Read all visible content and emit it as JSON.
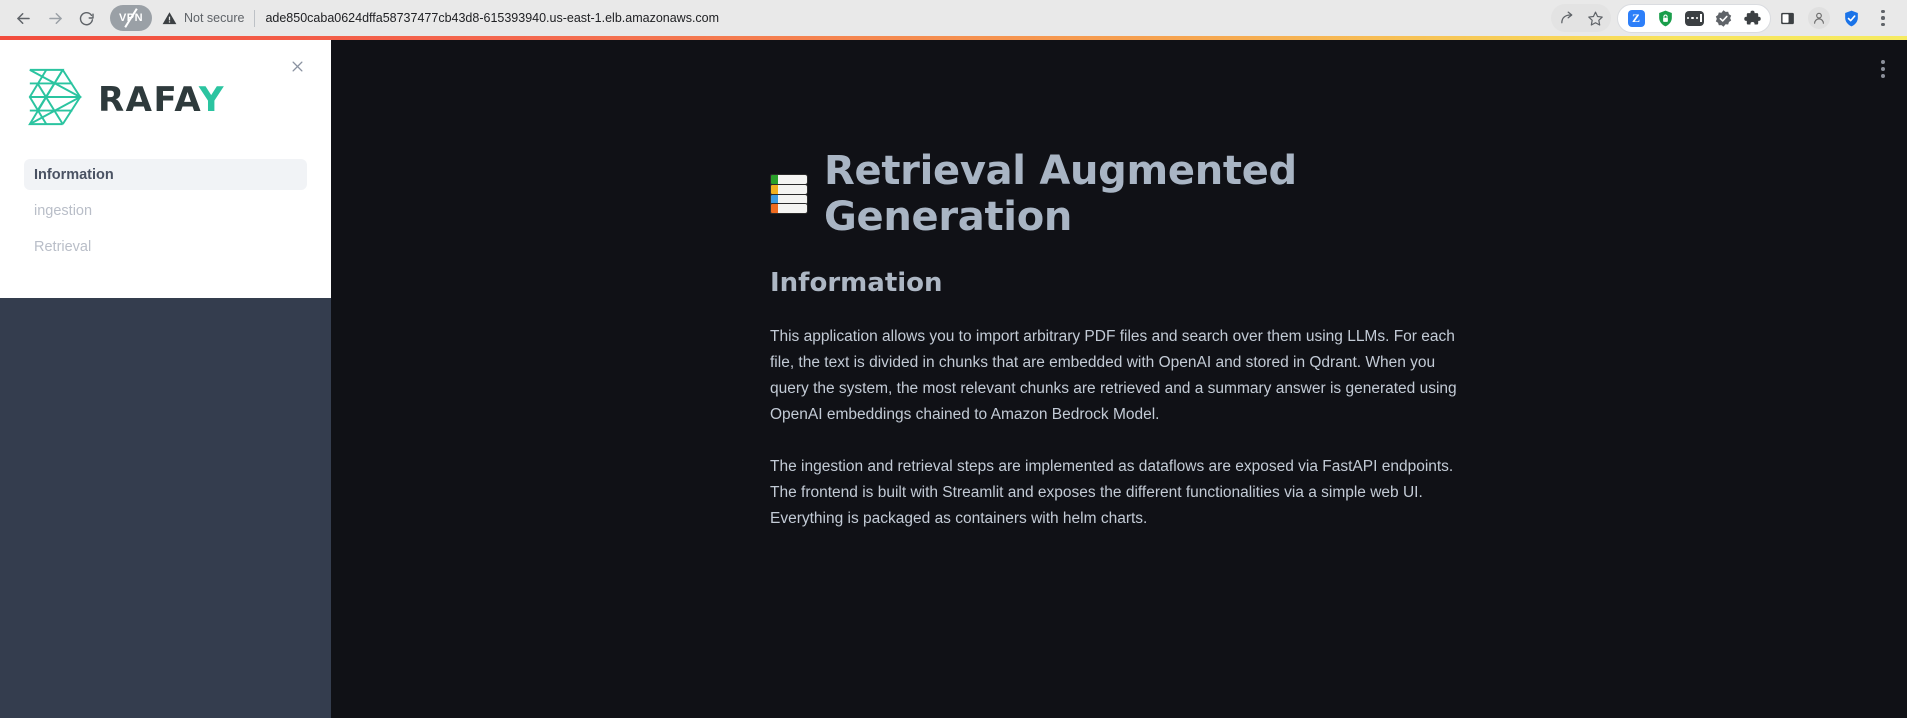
{
  "browser": {
    "back_icon": "back-arrow-icon",
    "forward_icon": "forward-arrow-icon",
    "reload_icon": "reload-icon",
    "vpn_label": "VPN",
    "security_label": "Not secure",
    "url": "ade850caba0624dffa58737477cb43d8-615393940.us-east-1.elb.amazonaws.com",
    "extensions": [
      {
        "name": "zotero-extension-icon",
        "glyph": "Z",
        "color": "#2d7ff9"
      },
      {
        "name": "password-shield-extension-icon",
        "glyph": "lock",
        "color": "#1a9e4b"
      },
      {
        "name": "password-manager-extension-icon",
        "glyph": "dots",
        "color": "#3c4043"
      },
      {
        "name": "verified-badge-extension-icon",
        "glyph": "check-badge",
        "color": "#5f6368"
      },
      {
        "name": "extensions-puzzle-icon",
        "glyph": "puzzle",
        "color": "#3c4043"
      }
    ],
    "side_panel_icon": "side-panel-icon",
    "profile_icon": "profile-avatar-icon",
    "security_shield_icon": "security-shield-icon",
    "menu_icon": "browser-menu-kebab-icon",
    "share_icon": "share-icon",
    "bookmark_icon": "bookmark-star-icon"
  },
  "sidebar": {
    "brand": {
      "logo_icon": "rafay-lattice-logo-icon",
      "name_main": "RAFA",
      "name_accent": "Y",
      "logo_color": "#2bc4a0",
      "text_color": "#2e3a3c"
    },
    "close_icon": "close-icon",
    "items": [
      {
        "label": "Information",
        "active": true
      },
      {
        "label": "ingestion",
        "active": false
      },
      {
        "label": "Retrieval",
        "active": false
      }
    ]
  },
  "main": {
    "menu_icon": "app-menu-kebab-icon",
    "title_icon": "books-emoji-icon",
    "title": "Retrieval Augmented Generation",
    "section_heading": "Information",
    "paragraphs": [
      "This application allows you to import arbitrary PDF files and search over them using LLMs. For each file, the text is divided in chunks that are embedded with OpenAI and stored in Qdrant. When you query the system, the most relevant chunks are retrieved and a summary answer is generated using OpenAI embeddings chained to Amazon Bedrock Model.",
      "The ingestion and retrieval steps are implemented as dataflows are exposed via FastAPI endpoints. The frontend is built with Streamlit and exposes the different functionalities via a simple web UI. Everything is packaged as containers with helm charts."
    ]
  },
  "theme": {
    "accent_gradient_start": "#f24c3d",
    "accent_gradient_end": "#f6eb61",
    "app_background": "#101116",
    "sidebar_background": "#343d4e",
    "panel_background": "#ffffff"
  }
}
